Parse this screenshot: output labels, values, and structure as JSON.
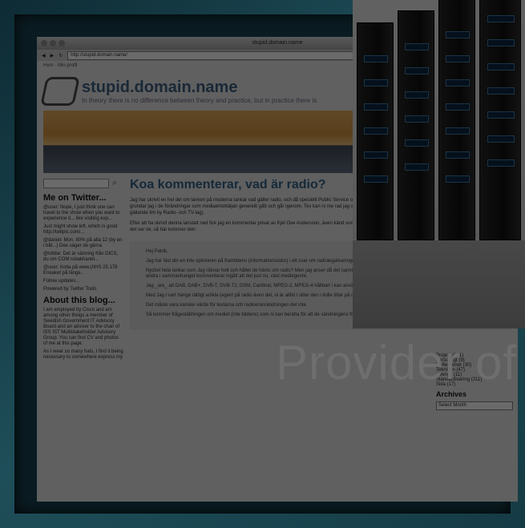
{
  "window": {
    "title": "stupid.domain.name"
  },
  "address_bar": {
    "url": "http://stupid.domain.name/"
  },
  "breadcrumb": "Hem  ·  Min profil",
  "site": {
    "title": "stupid.domain.name",
    "tagline": "In theory there is no difference between theory and practice, but in practice there is"
  },
  "sidebar": {
    "twitter_heading": "Me on Twitter...",
    "tweets": [
      "@user: Nope, I just think one can travel to the show when you want to experience it... like visiting exp...",
      "Just might show left, which is good http://twitpic.com/...",
      "@daniel: Mon, 80% på alla 12 (by en i båt...) Dee säger de gärna",
      "@tobbe: Det är sänning från DICS, du om COM rubakhanet...",
      "@user: Kolla på www.(IIHS 25.178 Eneaket på länge.."
    ],
    "follow_link": "Follow updates...",
    "powered": "Powered by Twitter Tools",
    "about_heading": "About this blog...",
    "about_text": "I am employed by Cisco and am among other things a member of Swedish Government IT Advisory Board and an adviser to the chair of ISS IST Multistakeholder Advisory Group. You can find CV and photos of me at this page.",
    "about_text2": "As I wear so many hats, I find it being necessary to somewhere express my"
  },
  "post": {
    "title": "Koa kommenterar, vad är radio?",
    "para1": "Jag har skrivit en hel del om lanken på moderna tankar vad gäller radio, och då speciellt Public Service och dess roll i dagens (och framtidens) mediaemottäljan. Flera tankar grundar jag i de förändringar som mediaemottäljan generellt gått och går igenom. Tex kan ni me rad jag skrivit om den pågående texuten från Regeringen (Luggetidenrtimes gällande tim ky Radio- och TV-lag).",
    "para2": "Efter att ha skrivit denna lanstatt ned fick jag en kommentar privat av Kjel Ove Andersson, även känd som Koa. Jag frågade honom om det var ok att återpublicera hans text, och det var ok, så här kommer den:",
    "comment": [
      "Hej Patrik,",
      "Jag har läst din en inte opinionen på framtidens (informationssidor) i ett svar om radiolegaliseringen, vilket den 6:e september 2005.",
      "Nyckel hela tankar som Jag räknar helt och hållet de hänts om radio? Men jag anser då det samma med om något det växte, fler frågor sig hon är. Varken du eller andra i sammanhanget kommenterar ingått att det just nu, växt mediegenre.",
      "Jag _are_ att DAB, DAB+, DVB-T, DVB-T2, DSM, Cardinal, MPEG-2, MPEG-4 hållbart i kan användas, på att de olika kombinationen ser.",
      "Med Jag i vart hänge rättigt artikla (egent på radio även det, ni är alltid i sitter den i dolle tittar på dessa kopplingar.",
      "Det måste vara kanske värde för textarna och radioeranrändningen det inte.",
      "Så kommer frågeställningen om mediet (inte bildens) som ni kan berätta för att de sändningens förde ABC, mediet som ni kan intervent sätt att lägga den med ner."
    ]
  },
  "rightcol": {
    "archives_heading": "Archives",
    "select_placeholder": "Select Month",
    "links": [
      "Projekt (181)",
      "Personligt (9)",
      "Reflektioner (30)",
      "Tekniken (47)",
      "Sverige (11)",
      "Standardisering (211)",
      "Sida (17)"
    ]
  },
  "overlay": {
    "caption": "Provider of"
  },
  "colors": {
    "link": "#3d6b8f",
    "frame": "#1e4e59"
  }
}
